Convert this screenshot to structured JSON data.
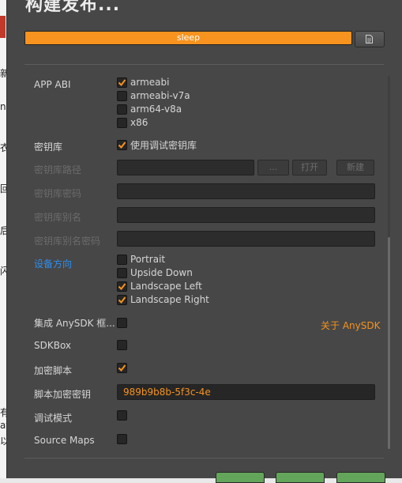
{
  "dialog": {
    "title": "构建发布...",
    "progress": {
      "label": "sleep",
      "value": 1.0
    }
  },
  "background_fragments": [
    "新",
    "n",
    "衣",
    "回",
    "后",
    "闪",
    "有",
    "at",
    "以"
  ],
  "form": {
    "app_abi": {
      "label": "APP ABI",
      "options": [
        {
          "label": "armeabi",
          "checked": true
        },
        {
          "label": "armeabi-v7a",
          "checked": false
        },
        {
          "label": "arm64-v8a",
          "checked": false
        },
        {
          "label": "x86",
          "checked": false
        }
      ]
    },
    "keystore": {
      "label": "密钥库",
      "checkbox_label": "使用调试密钥库",
      "checked": true
    },
    "keystore_path": {
      "label": "密钥库路径",
      "browse": "...",
      "open": "打开",
      "new": "新建"
    },
    "keystore_password": {
      "label": "密钥库密码"
    },
    "keystore_alias": {
      "label": "密钥库别名"
    },
    "alias_password": {
      "label": "密钥库别名密码"
    },
    "orientation": {
      "label": "设备方向",
      "options": [
        {
          "label": "Portrait",
          "checked": false
        },
        {
          "label": "Upside Down",
          "checked": false
        },
        {
          "label": "Landscape Left",
          "checked": true
        },
        {
          "label": "Landscape Right",
          "checked": true
        }
      ]
    },
    "anysdk": {
      "label": "集成 AnySDK 框...",
      "checked": false,
      "link": "关于 AnySDK"
    },
    "sdkbox": {
      "label": "SDKBox",
      "checked": false
    },
    "encrypt_script": {
      "label": "加密脚本",
      "checked": true
    },
    "script_key": {
      "label": "脚本加密密钥",
      "value": "989b9b8b-5f3c-4e"
    },
    "debug_mode": {
      "label": "调试模式",
      "checked": false
    },
    "source_maps": {
      "label": "Source Maps",
      "checked": false
    }
  },
  "colors": {
    "accent": "#f7931e",
    "link": "#2e8ff0",
    "panel": "#474747",
    "button_green": "#63a55a"
  }
}
